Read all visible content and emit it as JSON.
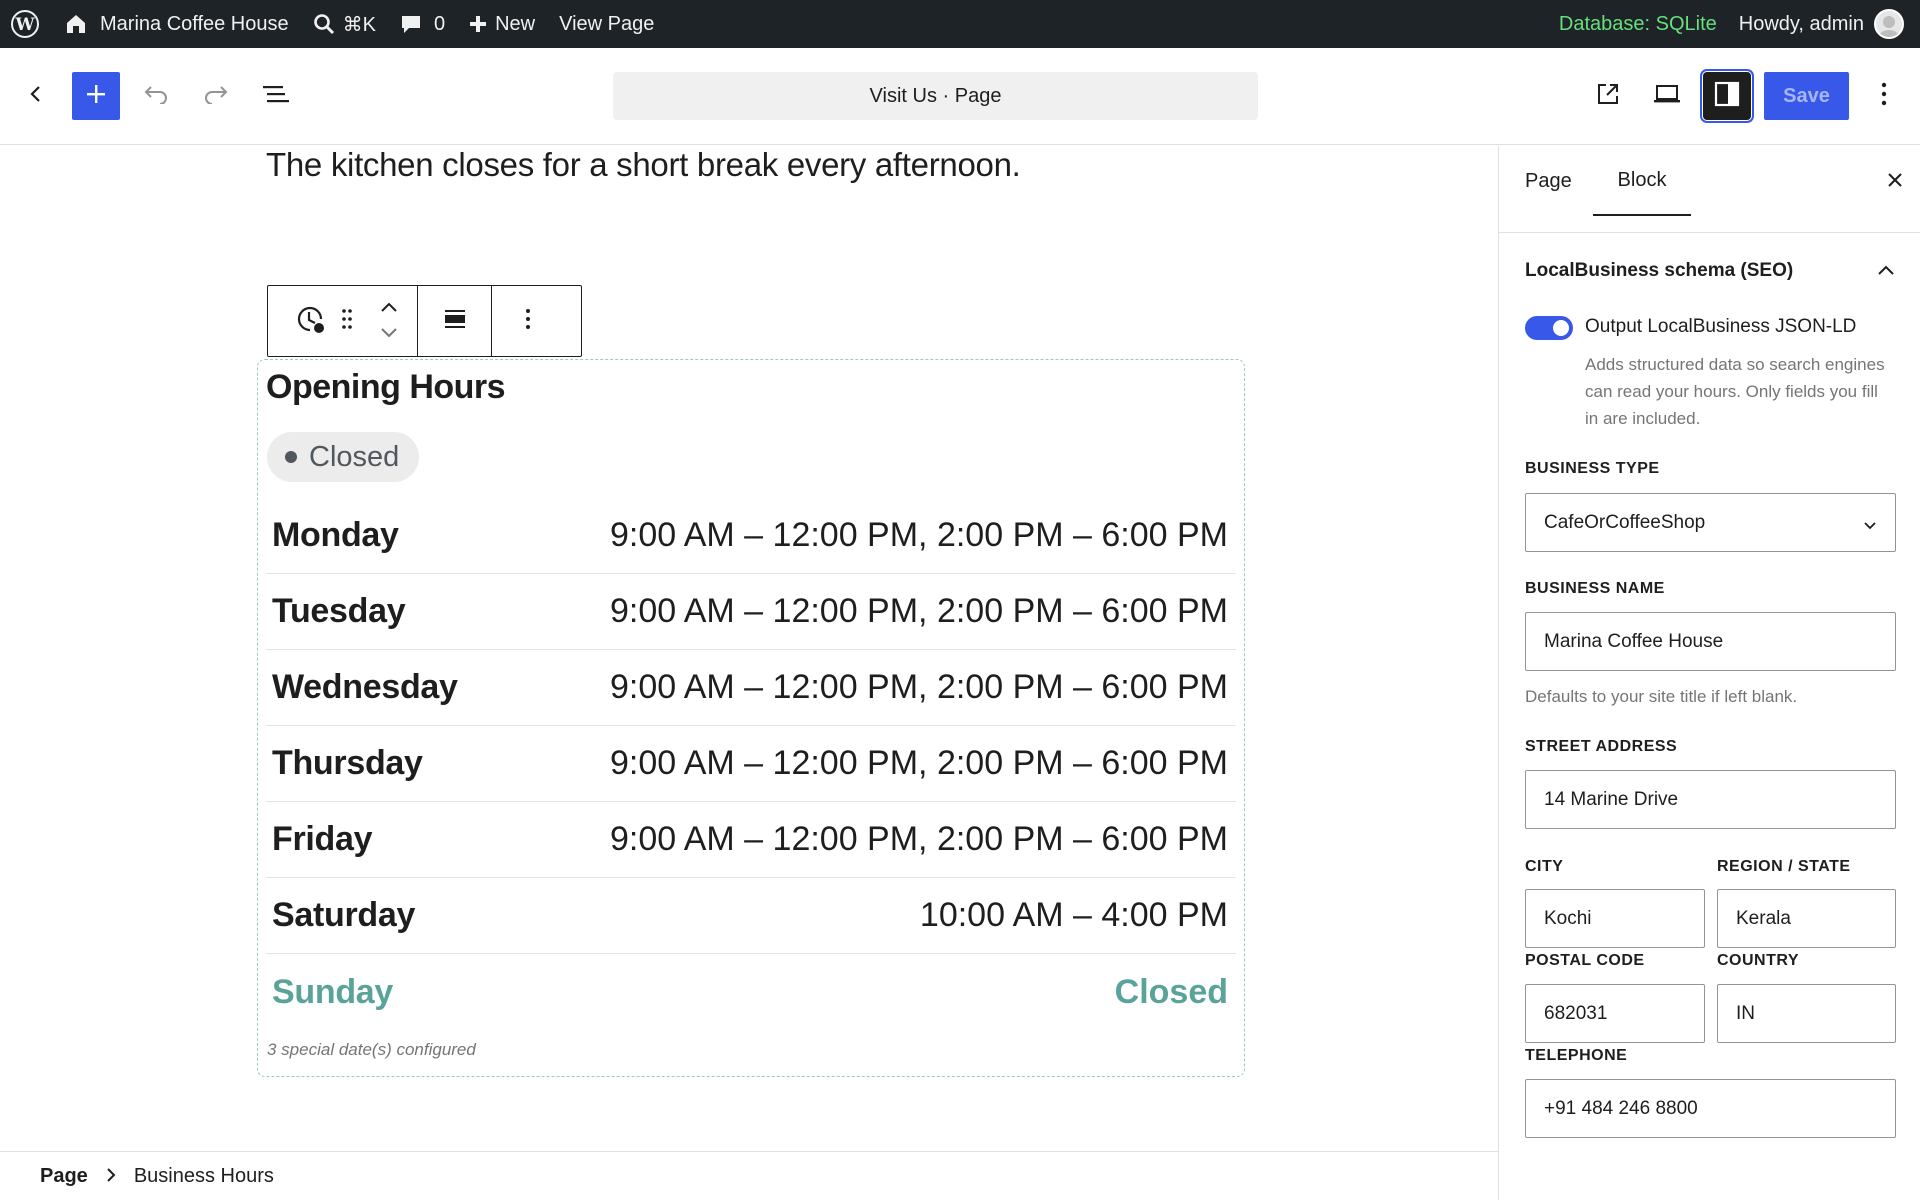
{
  "admin_bar": {
    "site_name": "Marina Coffee House",
    "search_shortcut": "⌘K",
    "comments_count": "0",
    "new_label": "New",
    "view_page_label": "View Page",
    "database_label": "Database: SQLite",
    "howdy_label": "Howdy, admin"
  },
  "header": {
    "document_title": "Visit Us · Page",
    "save_label": "Save"
  },
  "content": {
    "paragraph": "The kitchen closes for a short break every afternoon.",
    "hours_block": {
      "title": "Opening Hours",
      "status": "Closed",
      "rows": [
        {
          "day": "Monday",
          "time": "9:00 AM – 12:00 PM, 2:00 PM – 6:00 PM"
        },
        {
          "day": "Tuesday",
          "time": "9:00 AM – 12:00 PM, 2:00 PM – 6:00 PM"
        },
        {
          "day": "Wednesday",
          "time": "9:00 AM – 12:00 PM, 2:00 PM – 6:00 PM"
        },
        {
          "day": "Thursday",
          "time": "9:00 AM – 12:00 PM, 2:00 PM – 6:00 PM"
        },
        {
          "day": "Friday",
          "time": "9:00 AM – 12:00 PM, 2:00 PM – 6:00 PM"
        },
        {
          "day": "Saturday",
          "time": "10:00 AM – 4:00 PM"
        },
        {
          "day": "Sunday",
          "time": "Closed"
        }
      ],
      "special_dates": "3 special date(s) configured"
    }
  },
  "breadcrumb": {
    "root": "Page",
    "current": "Business Hours"
  },
  "sidebar": {
    "tabs": [
      "Page",
      "Block"
    ],
    "active_tab": "Block",
    "panel_title": "LocalBusiness schema (SEO)",
    "toggle_label": "Output LocalBusiness JSON-LD",
    "toggle_help": "Adds structured data so search engines can read your hours. Only fields you fill in are included.",
    "business_type_label": "Business type",
    "business_type_value": "CafeOrCoffeeShop",
    "business_name_label": "Business name",
    "business_name_value": "Marina Coffee House",
    "business_name_help": "Defaults to your site title if left blank.",
    "street_label": "Street address",
    "street_value": "14 Marine Drive",
    "city_label": "City",
    "city_value": "Kochi",
    "region_label": "Region / State",
    "region_value": "Kerala",
    "postal_label": "Postal code",
    "postal_value": "682031",
    "country_label": "Country",
    "country_value": "IN",
    "telephone_label": "Telephone",
    "telephone_value": "+91 484 246 8800"
  },
  "colors": {
    "accent": "#3858e9",
    "admin_bar_bg": "#1d2327",
    "closed_day": "#5aa39a",
    "database_label": "#68de7c"
  }
}
